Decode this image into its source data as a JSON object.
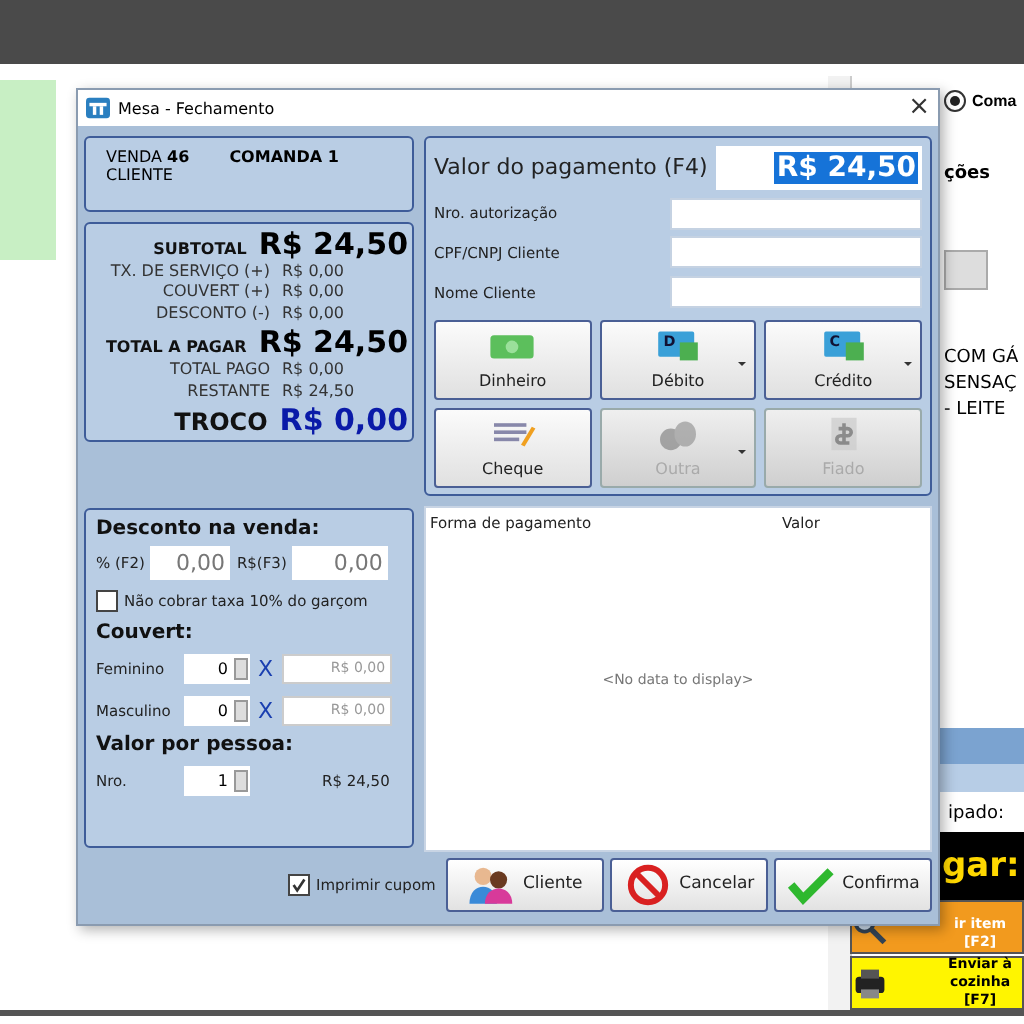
{
  "dialog": {
    "title": "Mesa - Fechamento",
    "close": "×"
  },
  "header": {
    "venda_label": "VENDA",
    "venda": "46",
    "comanda": "COMANDA 1",
    "cliente_label": "CLIENTE"
  },
  "totals": [
    {
      "label": "SUBTOTAL",
      "value": "R$ 24,50",
      "kind": "big"
    },
    {
      "label": "TX. DE SERVIÇO (+)",
      "value": "R$ 0,00",
      "kind": "small"
    },
    {
      "label": "COUVERT (+)",
      "value": "R$ 0,00",
      "kind": "small"
    },
    {
      "label": "DESCONTO (-)",
      "value": "R$ 0,00",
      "kind": "small"
    },
    {
      "label": "TOTAL A PAGAR",
      "value": "R$ 24,50",
      "kind": "big"
    },
    {
      "label": "TOTAL PAGO",
      "value": "R$ 0,00",
      "kind": "small"
    },
    {
      "label": "RESTANTE",
      "value": "R$ 24,50",
      "kind": "small"
    },
    {
      "label": "TROCO",
      "value": "R$ 0,00",
      "kind": "troco"
    }
  ],
  "discount": {
    "title": "Desconto na venda:",
    "percent_label": "% (F2)",
    "percent": "0,00",
    "money_label": "R$(F3)",
    "money": "0,00",
    "no_tax": {
      "label": "Não cobrar taxa 10% do garçom",
      "checked": false
    }
  },
  "couvert": {
    "title": "Couvert:",
    "rows": [
      {
        "label": "Feminino",
        "count": "0",
        "times": "X",
        "price": "R$ 0,00"
      },
      {
        "label": "Masculino",
        "count": "0",
        "times": "X",
        "price": "R$ 0,00"
      }
    ]
  },
  "per_person": {
    "title": "Valor por pessoa:",
    "label": "Nro.",
    "count": "1",
    "value": "R$ 24,50"
  },
  "payment": {
    "value_label": "Valor do pagamento (F4)",
    "value": "R$ 24,50",
    "fields": [
      {
        "label": "Nro. autorização"
      },
      {
        "label": "CPF/CNPJ Cliente"
      },
      {
        "label": "Nome Cliente"
      }
    ]
  },
  "methods": [
    {
      "label": "Dinheiro",
      "kind": "cash",
      "disabled": false,
      "dropdown": false
    },
    {
      "label": "Débito",
      "kind": "debit",
      "icon_letter": "D",
      "disabled": false,
      "dropdown": true
    },
    {
      "label": "Crédito",
      "kind": "credit",
      "icon_letter": "C",
      "disabled": false,
      "dropdown": true
    },
    {
      "label": "Cheque",
      "kind": "cheque",
      "disabled": false,
      "dropdown": false
    },
    {
      "label": "Outra",
      "kind": "other",
      "disabled": true,
      "dropdown": true
    },
    {
      "label": "Fiado",
      "kind": "fiado",
      "disabled": true,
      "dropdown": false
    }
  ],
  "grid": {
    "columns": [
      "Forma de pagamento",
      "Valor"
    ],
    "empty": "<No data to display>"
  },
  "print_receipt": {
    "label": "Imprimir cupom",
    "checked": true
  },
  "actions": [
    {
      "label": "Cliente",
      "kind": "client"
    },
    {
      "label": "Cancelar",
      "kind": "cancel"
    },
    {
      "label": "Confirma",
      "kind": "confirm"
    }
  ],
  "background": {
    "radio": {
      "label": "Coma",
      "selected": true
    },
    "column": "ções",
    "items": [
      "COM GÁ",
      "SENSAÇ",
      "- LEITE"
    ],
    "status": "ipado:",
    "banner": "gar:",
    "buttons": [
      {
        "label": "ir item [F2]",
        "kind": "search"
      },
      {
        "label": "Enviar à cozinha [F7]",
        "kind": "print"
      }
    ]
  }
}
